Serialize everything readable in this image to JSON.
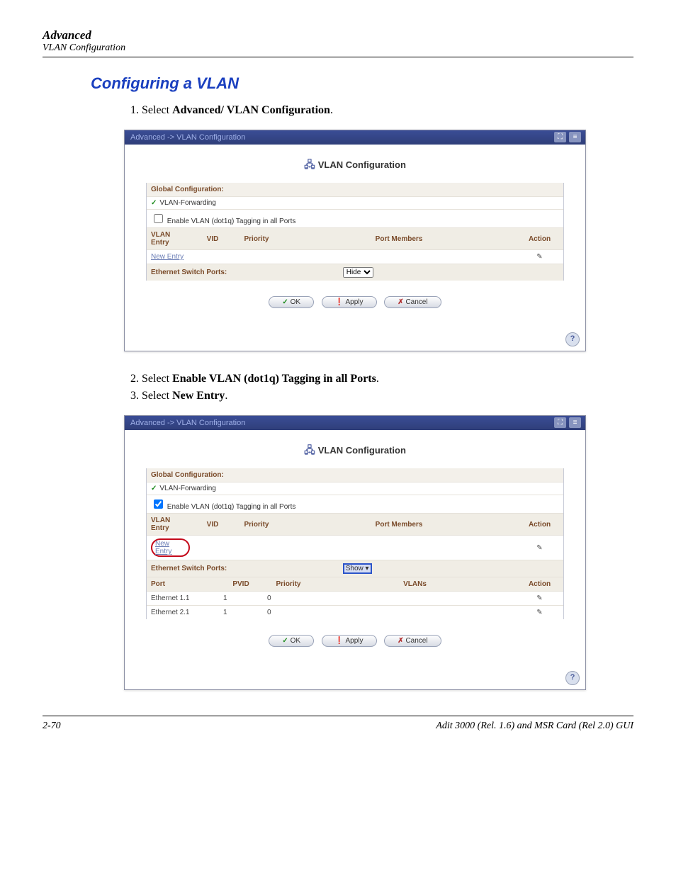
{
  "header": {
    "title": "Advanced",
    "sub": "VLAN Configuration"
  },
  "section_title": "Configuring a VLAN",
  "steps": {
    "s1_pre": "Select ",
    "s1_b": "Advanced/ VLAN Configuration",
    "s1_post": ".",
    "s2_pre": "Select ",
    "s2_b": "Enable VLAN (dot1q) Tagging in all Ports",
    "s2_post": ".",
    "s3_pre": "Select ",
    "s3_b": "New Entry",
    "s3_post": "."
  },
  "shot1": {
    "breadcrumb": "Advanced -> VLAN Configuration",
    "title": "VLAN Configuration",
    "global_label": "Global Configuration:",
    "vlan_fwd": "VLAN-Forwarding",
    "enable_tag": "Enable VLAN (dot1q) Tagging in all Ports",
    "enable_tag_checked": false,
    "cols": {
      "entry": "VLAN Entry",
      "vid": "VID",
      "priority": "Priority",
      "members": "Port Members",
      "action": "Action"
    },
    "new_entry": "New Entry",
    "esp_label": "Ethernet Switch Ports:",
    "esp_select": "Hide",
    "buttons": {
      "ok": "OK",
      "apply": "Apply",
      "cancel": "Cancel"
    }
  },
  "shot2": {
    "breadcrumb": "Advanced -> VLAN Configuration",
    "title": "VLAN Configuration",
    "global_label": "Global Configuration:",
    "vlan_fwd": "VLAN-Forwarding",
    "enable_tag": "Enable VLAN (dot1q) Tagging in all Ports",
    "enable_tag_checked": true,
    "cols": {
      "entry": "VLAN Entry",
      "vid": "VID",
      "priority": "Priority",
      "members": "Port Members",
      "action": "Action"
    },
    "new_entry": "New Entry",
    "esp_label": "Ethernet Switch Ports:",
    "esp_select": "Show",
    "ports_cols": {
      "port": "Port",
      "pvid": "PVID",
      "priority": "Priority",
      "vlans": "VLANs",
      "action": "Action"
    },
    "ports": [
      {
        "port": "Ethernet 1.1",
        "pvid": "1",
        "priority": "0",
        "vlans": ""
      },
      {
        "port": "Ethernet 2.1",
        "pvid": "1",
        "priority": "0",
        "vlans": ""
      }
    ],
    "buttons": {
      "ok": "OK",
      "apply": "Apply",
      "cancel": "Cancel"
    }
  },
  "footer": {
    "page": "2-70",
    "product": "Adit 3000 (Rel. 1.6) and MSR Card (Rel 2.0) GUI"
  }
}
